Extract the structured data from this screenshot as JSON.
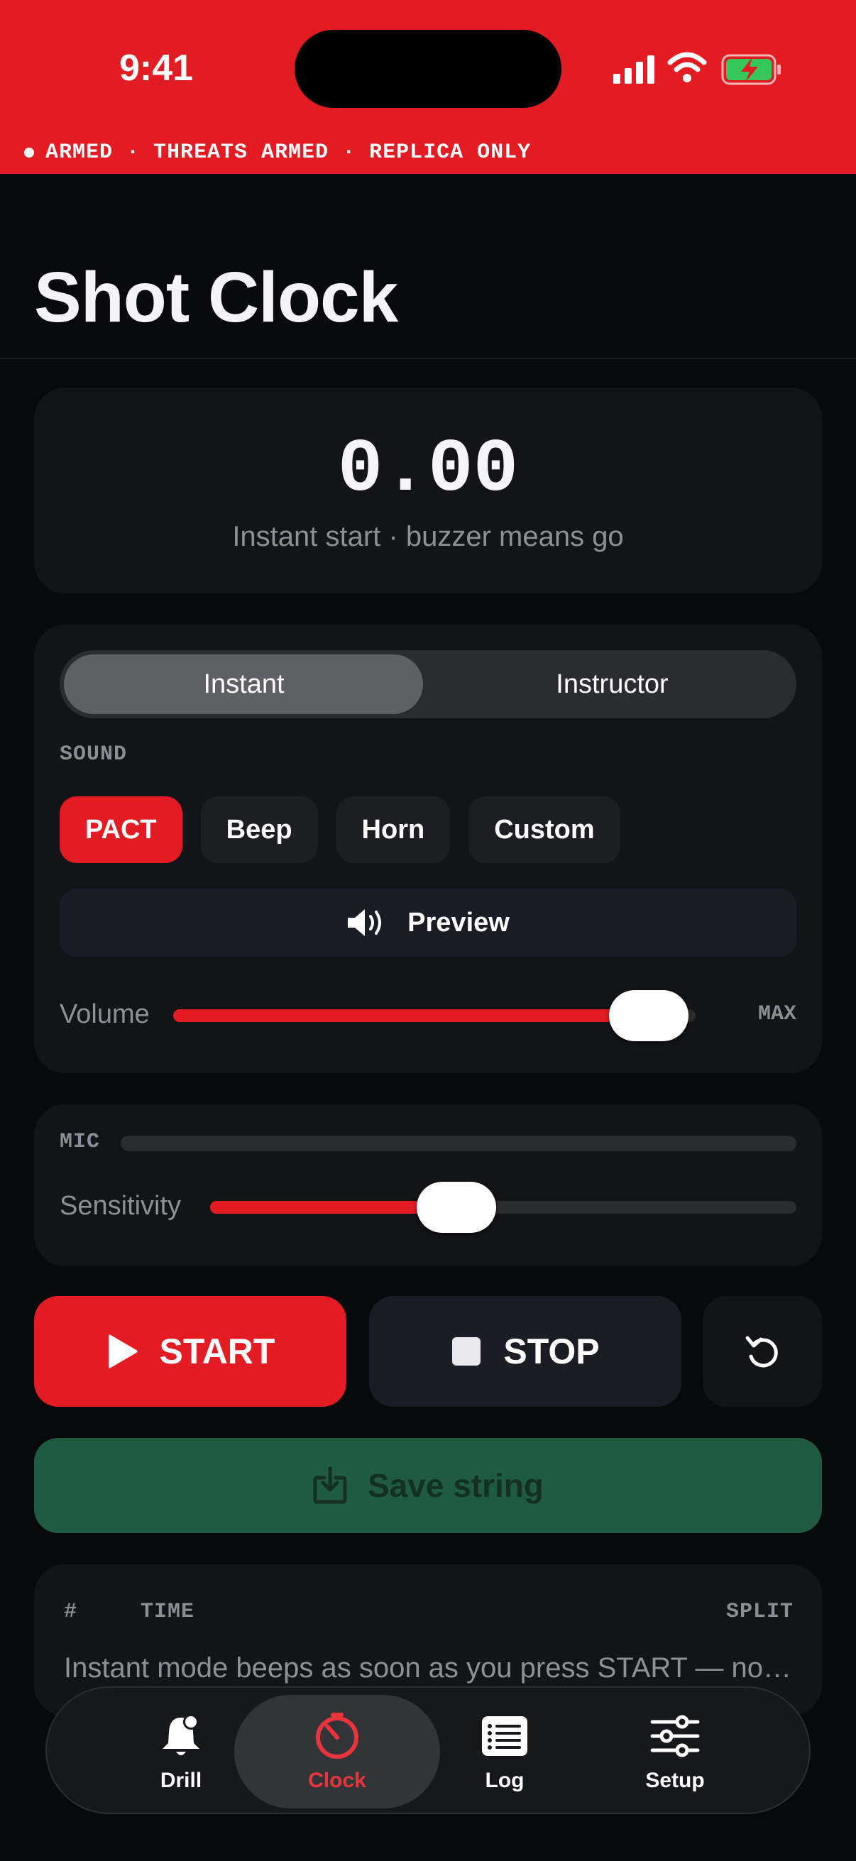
{
  "status_bar": {
    "time": "9:41"
  },
  "banner": {
    "text": "ARMED · THREATS ARMED · REPLICA ONLY"
  },
  "header": {
    "title": "Shot Clock"
  },
  "timer": {
    "value": "0.00",
    "subtitle": "Instant start · buzzer means go"
  },
  "mode": {
    "options": [
      "Instant",
      "Instructor"
    ],
    "selected": "Instant"
  },
  "sound": {
    "label": "SOUND",
    "options": [
      "PACT",
      "Beep",
      "Horn",
      "Custom"
    ],
    "selected": "PACT",
    "preview_label": "Preview",
    "volume_label": "Volume",
    "volume_value_label": "MAX",
    "volume_fraction": 0.91
  },
  "mic": {
    "label": "MIC",
    "level_fraction": 0.0,
    "sensitivity_label": "Sensitivity",
    "sensitivity_fraction": 0.42
  },
  "controls": {
    "start_label": "START",
    "stop_label": "STOP",
    "save_label": "Save string"
  },
  "splits": {
    "headers": {
      "index": "#",
      "time": "TIME",
      "split": "SPLIT"
    },
    "empty_note": "Instant mode beeps as soon as you press START — no random delay."
  },
  "tabs": [
    {
      "label": "Drill",
      "icon": "bell-icon"
    },
    {
      "label": "Clock",
      "icon": "stopwatch-icon"
    },
    {
      "label": "Log",
      "icon": "list-icon"
    },
    {
      "label": "Setup",
      "icon": "sliders-icon"
    }
  ],
  "active_tab": "Clock",
  "colors": {
    "accent": "#e31b23",
    "card": "#131418",
    "background": "#08090b",
    "save_green": "#1f5c3f"
  }
}
